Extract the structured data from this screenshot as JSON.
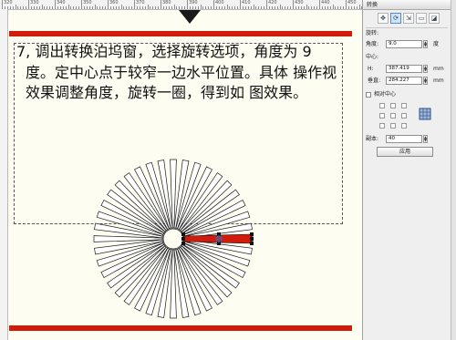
{
  "ruler": {
    "labels": [
      "320",
      "330",
      "340",
      "350",
      "360",
      "370",
      "380",
      "390",
      "400",
      "410",
      "420",
      "430",
      "440",
      "450"
    ]
  },
  "instruction": "7, 调出转换泊坞窗，选择旋转选项，角度为 9度。定中心点于较窄一边水平位置。具体 操作视效果调整角度，旋转一圈，得到如 图效果。",
  "colors": {
    "red_bar": "#d21b0a",
    "canvas": "#fdfdf2",
    "wedge": "#d21b0a"
  },
  "artwork": {
    "rotation_step_deg": 9,
    "copies": 40
  },
  "docker": {
    "title": "转换",
    "tabs": [
      {
        "icon": "position-icon",
        "glyph": "✥"
      },
      {
        "icon": "rotate-icon",
        "glyph": "⟳"
      },
      {
        "icon": "scale-icon",
        "glyph": "⇲"
      },
      {
        "icon": "size-icon",
        "glyph": "▭"
      },
      {
        "icon": "skew-icon",
        "glyph": "◪"
      }
    ],
    "section": "旋转:",
    "angle_label": "角度:",
    "angle_value": "9.0",
    "angle_unit": "度",
    "center_label": "中心:",
    "h_label": "H:",
    "h_value": "387.419",
    "v_label": "垂直:",
    "v_value": "284.227",
    "unit": "mm",
    "relative_center_label": "相对中心",
    "copies_label": "副本:",
    "copies_value": "40",
    "apply_label": "应用"
  }
}
